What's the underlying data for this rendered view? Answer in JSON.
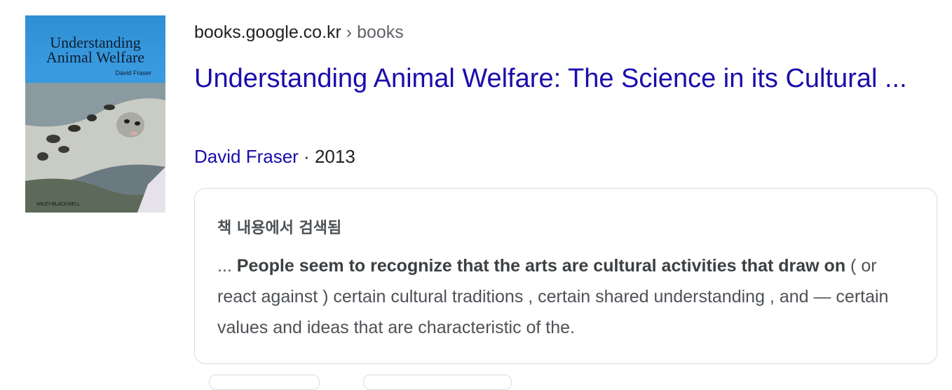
{
  "result": {
    "thumbnail": {
      "cover_title_line1": "Understanding",
      "cover_title_line2": "Animal Welfare",
      "cover_author": "David Fraser",
      "publisher": "WILEY-BLACKWELL"
    },
    "url": {
      "domain": "books.google.co.kr",
      "separator": " › ",
      "path": "books"
    },
    "title": "Understanding Animal Welfare: The Science in its Cultural ...",
    "meta": {
      "author": "David Fraser",
      "separator": " · ",
      "year": "2013"
    },
    "snippet": {
      "header": "책 내용에서 검색됨",
      "prefix": "... ",
      "bold": "People seem to recognize that the arts are cultural activities that draw on",
      "rest": " ( or react against ) certain cultural traditions , certain shared understanding , and — certain values and ideas that are characteristic of the."
    }
  },
  "colors": {
    "link": "#1a0dab",
    "text": "#202124",
    "muted": "#5f6368",
    "snippet": "#4d5156",
    "border": "#dadce0",
    "cover_blue": "#2f8fd3"
  }
}
